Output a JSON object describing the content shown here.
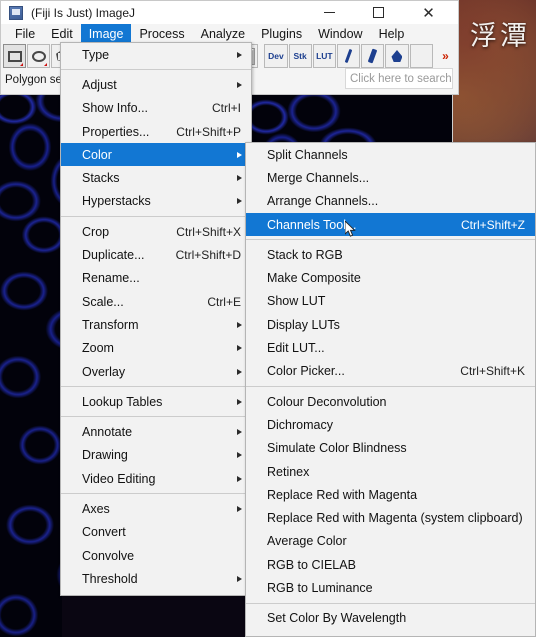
{
  "window": {
    "title": "(Fiji Is Just) ImageJ",
    "app_icon": "imagej-icon",
    "minimize": "–",
    "maximize": "□",
    "close": "✕"
  },
  "desktop": {
    "wallpaper_text": "浮潭"
  },
  "menubar": {
    "items": [
      {
        "label": "File",
        "active": false
      },
      {
        "label": "Edit",
        "active": false
      },
      {
        "label": "Image",
        "active": true
      },
      {
        "label": "Process",
        "active": false
      },
      {
        "label": "Analyze",
        "active": false
      },
      {
        "label": "Plugins",
        "active": false
      },
      {
        "label": "Window",
        "active": false
      },
      {
        "label": "Help",
        "active": false
      }
    ]
  },
  "toolbar": {
    "tools": [
      {
        "name": "rectangle-tool",
        "label": ""
      },
      {
        "name": "oval-tool",
        "label": ""
      },
      {
        "name": "polygon-tool",
        "label": ""
      },
      {
        "name": "color-swatch-tool",
        "label": ""
      },
      {
        "name": "dev-tool",
        "label": "Dev"
      },
      {
        "name": "stk-tool",
        "label": "Stk"
      },
      {
        "name": "lut-tool",
        "label": "LUT"
      },
      {
        "name": "pencil-tool",
        "label": ""
      },
      {
        "name": "brush-tool",
        "label": ""
      },
      {
        "name": "fill-tool",
        "label": ""
      },
      {
        "name": "empty-tool",
        "label": ""
      },
      {
        "name": "more-tools",
        "label": "»"
      }
    ]
  },
  "status": {
    "text": "Polygon sele"
  },
  "search": {
    "placeholder": "Click here to search",
    "value": ""
  },
  "image_menu": {
    "items": [
      {
        "label": "Type",
        "accel": "",
        "submenu": true,
        "highlighted": false
      },
      {
        "separator": true
      },
      {
        "label": "Adjust",
        "accel": "",
        "submenu": true,
        "highlighted": false
      },
      {
        "label": "Show Info...",
        "accel": "Ctrl+I",
        "submenu": false,
        "highlighted": false
      },
      {
        "label": "Properties...",
        "accel": "Ctrl+Shift+P",
        "submenu": false,
        "highlighted": false
      },
      {
        "label": "Color",
        "accel": "",
        "submenu": true,
        "highlighted": true
      },
      {
        "label": "Stacks",
        "accel": "",
        "submenu": true,
        "highlighted": false
      },
      {
        "label": "Hyperstacks",
        "accel": "",
        "submenu": true,
        "highlighted": false
      },
      {
        "separator": true
      },
      {
        "label": "Crop",
        "accel": "Ctrl+Shift+X",
        "submenu": false,
        "highlighted": false
      },
      {
        "label": "Duplicate...",
        "accel": "Ctrl+Shift+D",
        "submenu": false,
        "highlighted": false
      },
      {
        "label": "Rename...",
        "accel": "",
        "submenu": false,
        "highlighted": false
      },
      {
        "label": "Scale...",
        "accel": "Ctrl+E",
        "submenu": false,
        "highlighted": false
      },
      {
        "label": "Transform",
        "accel": "",
        "submenu": true,
        "highlighted": false
      },
      {
        "label": "Zoom",
        "accel": "",
        "submenu": true,
        "highlighted": false
      },
      {
        "label": "Overlay",
        "accel": "",
        "submenu": true,
        "highlighted": false
      },
      {
        "separator": true
      },
      {
        "label": "Lookup Tables",
        "accel": "",
        "submenu": true,
        "highlighted": false
      },
      {
        "separator": true
      },
      {
        "label": "Annotate",
        "accel": "",
        "submenu": true,
        "highlighted": false
      },
      {
        "label": "Drawing",
        "accel": "",
        "submenu": true,
        "highlighted": false
      },
      {
        "label": "Video Editing",
        "accel": "",
        "submenu": true,
        "highlighted": false
      },
      {
        "separator": true
      },
      {
        "label": "Axes",
        "accel": "",
        "submenu": true,
        "highlighted": false
      },
      {
        "label": "Convert",
        "accel": "",
        "submenu": false,
        "highlighted": false
      },
      {
        "label": "Convolve",
        "accel": "",
        "submenu": false,
        "highlighted": false
      },
      {
        "label": "Threshold",
        "accel": "",
        "submenu": true,
        "highlighted": false
      }
    ]
  },
  "color_submenu": {
    "items": [
      {
        "label": "Split Channels",
        "accel": "",
        "highlighted": false
      },
      {
        "label": "Merge Channels...",
        "accel": "",
        "highlighted": false
      },
      {
        "label": "Arrange Channels...",
        "accel": "",
        "highlighted": false
      },
      {
        "label": "Channels Tool...",
        "accel": "Ctrl+Shift+Z",
        "highlighted": true
      },
      {
        "separator": true
      },
      {
        "label": "Stack to RGB",
        "accel": "",
        "highlighted": false
      },
      {
        "label": "Make Composite",
        "accel": "",
        "highlighted": false
      },
      {
        "label": "Show LUT",
        "accel": "",
        "highlighted": false
      },
      {
        "label": "Display LUTs",
        "accel": "",
        "highlighted": false
      },
      {
        "label": "Edit LUT...",
        "accel": "",
        "highlighted": false
      },
      {
        "label": "Color Picker...",
        "accel": "Ctrl+Shift+K",
        "highlighted": false
      },
      {
        "separator": true
      },
      {
        "label": "Colour Deconvolution",
        "accel": "",
        "highlighted": false
      },
      {
        "label": "Dichromacy",
        "accel": "",
        "highlighted": false
      },
      {
        "label": "Simulate Color Blindness",
        "accel": "",
        "highlighted": false
      },
      {
        "label": "Retinex",
        "accel": "",
        "highlighted": false
      },
      {
        "label": "Replace Red with Magenta",
        "accel": "",
        "highlighted": false
      },
      {
        "label": "Replace Red with Magenta (system clipboard)",
        "accel": "",
        "highlighted": false
      },
      {
        "label": "Average Color",
        "accel": "",
        "highlighted": false
      },
      {
        "label": "RGB to CIELAB",
        "accel": "",
        "highlighted": false
      },
      {
        "label": "RGB to Luminance",
        "accel": "",
        "highlighted": false
      },
      {
        "separator": true
      },
      {
        "label": "Set Color By Wavelength",
        "accel": "",
        "highlighted": false
      }
    ]
  },
  "colors": {
    "menu_highlight": "#1277d3",
    "menu_background": "#f2f2f2",
    "window_background": "#f4f4f4",
    "cell_image_blue": "#2230b4"
  }
}
